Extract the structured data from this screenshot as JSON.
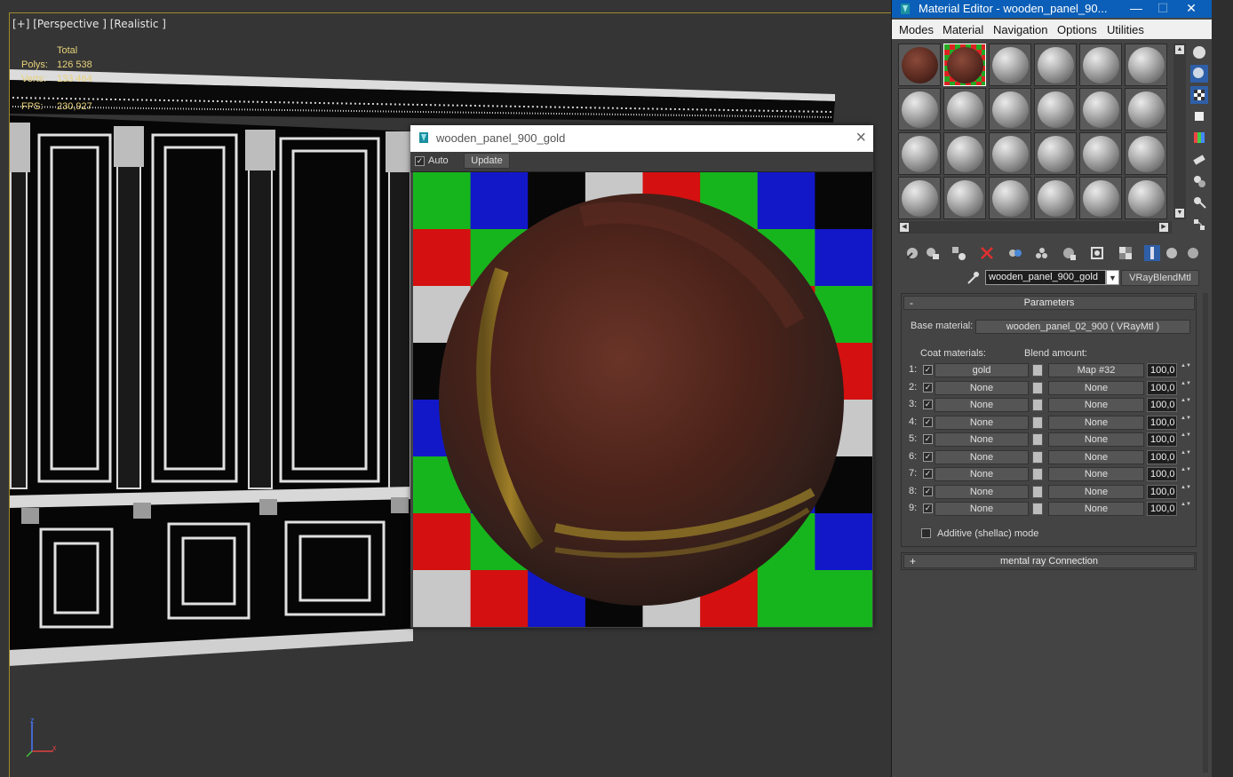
{
  "viewport": {
    "label": "[+] [Perspective ] [Realistic ]",
    "stats": {
      "total_label": "Total",
      "polys_label": "Polys:",
      "polys_value": "126 538",
      "verts_label": "Verts:",
      "verts_value": "133 464",
      "fps_label": "FPS:",
      "fps_value": "230,927"
    },
    "axis": {
      "x": "x",
      "z": "z"
    }
  },
  "preview_window": {
    "title": "wooden_panel_900_gold",
    "auto_label": "Auto",
    "auto_checked": true,
    "update_label": "Update"
  },
  "material_editor": {
    "title": "Material Editor - wooden_panel_90...",
    "window_buttons": [
      "—",
      "☐",
      "✕"
    ],
    "menu": [
      "Modes",
      "Material",
      "Navigation",
      "Options",
      "Utilities"
    ],
    "slot_count": 24,
    "material_name": "wooden_panel_900_gold",
    "material_type": "VRayBlendMtl",
    "parameters": {
      "header": "Parameters",
      "header_sign": "-",
      "base_material_label": "Base material:",
      "base_material_value": "wooden_panel_02_900  ( VRayMtl )",
      "coat_materials_label": "Coat materials:",
      "blend_amount_label": "Blend amount:",
      "coats": [
        {
          "index": "1:",
          "checked": true,
          "material": "gold",
          "blend": "Map #32",
          "amount": "100,0"
        },
        {
          "index": "2:",
          "checked": true,
          "material": "None",
          "blend": "None",
          "amount": "100,0"
        },
        {
          "index": "3:",
          "checked": true,
          "material": "None",
          "blend": "None",
          "amount": "100,0"
        },
        {
          "index": "4:",
          "checked": true,
          "material": "None",
          "blend": "None",
          "amount": "100,0"
        },
        {
          "index": "5:",
          "checked": true,
          "material": "None",
          "blend": "None",
          "amount": "100,0"
        },
        {
          "index": "6:",
          "checked": true,
          "material": "None",
          "blend": "None",
          "amount": "100,0"
        },
        {
          "index": "7:",
          "checked": true,
          "material": "None",
          "blend": "None",
          "amount": "100,0"
        },
        {
          "index": "8:",
          "checked": true,
          "material": "None",
          "blend": "None",
          "amount": "100,0"
        },
        {
          "index": "9:",
          "checked": true,
          "material": "None",
          "blend": "None",
          "amount": "100,0"
        }
      ],
      "additive_label": "Additive (shellac) mode",
      "additive_checked": false
    },
    "mental_ray": {
      "header": "mental ray Connection",
      "header_sign": "+"
    }
  }
}
